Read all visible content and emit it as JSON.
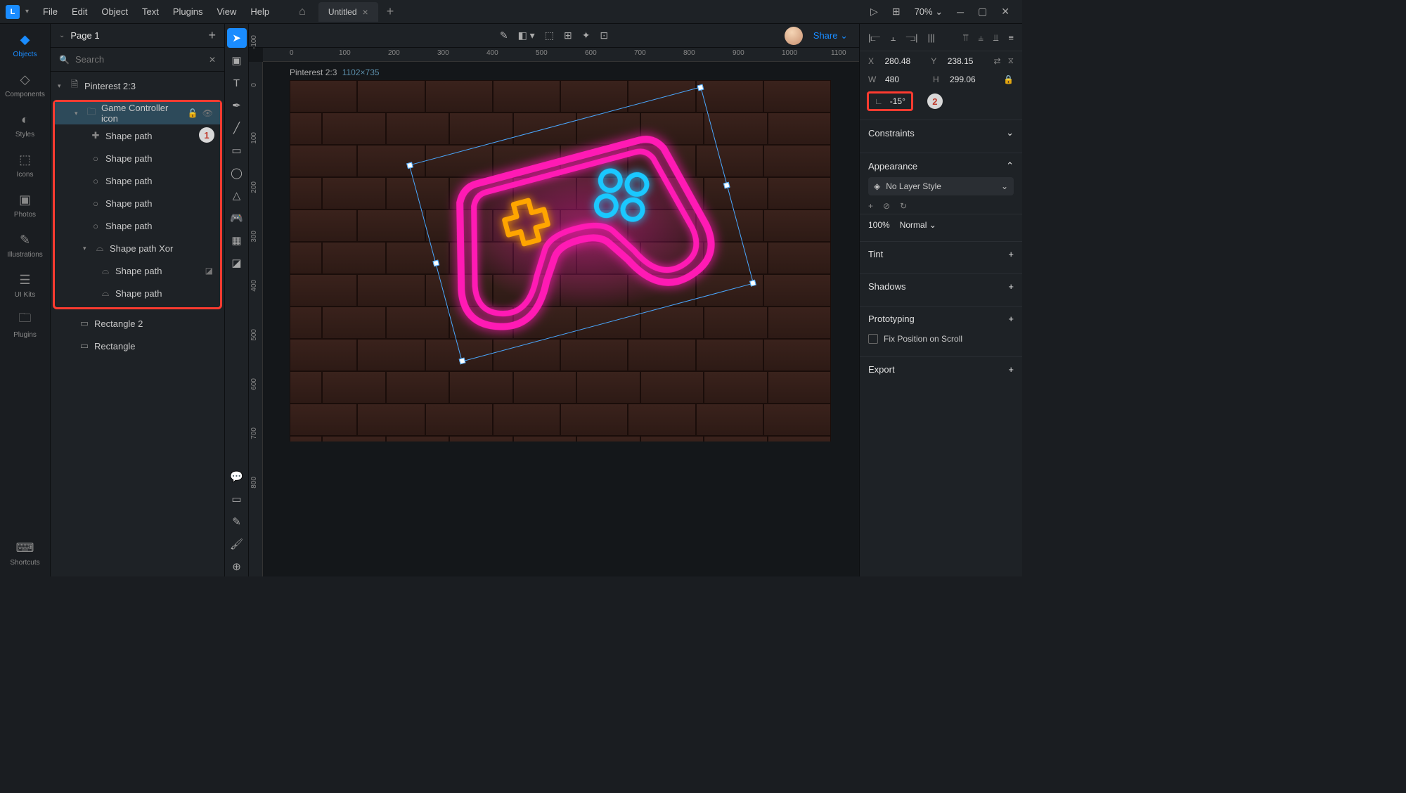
{
  "menubar": {
    "items": [
      "File",
      "Edit",
      "Object",
      "Text",
      "Plugins",
      "View",
      "Help"
    ],
    "tab_title": "Untitled",
    "zoom": "70%"
  },
  "rail": {
    "items": [
      {
        "label": "Objects",
        "icon": "layers-icon",
        "active": true
      },
      {
        "label": "Components",
        "icon": "components-icon"
      },
      {
        "label": "Styles",
        "icon": "styles-icon"
      },
      {
        "label": "Icons",
        "icon": "icons-icon"
      },
      {
        "label": "Photos",
        "icon": "photos-icon"
      },
      {
        "label": "Illustrations",
        "icon": "illustrations-icon"
      },
      {
        "label": "UI Kits",
        "icon": "uikits-icon"
      },
      {
        "label": "Plugins",
        "icon": "plugins-icon"
      },
      {
        "label": "Shortcuts",
        "icon": "shortcuts-icon"
      }
    ]
  },
  "layers": {
    "page_name": "Page 1",
    "search_placeholder": "Search",
    "root": "Pinterest 2:3",
    "group_name": "Game Controller icon",
    "shape_label": "Shape path",
    "xor_label": "Shape path Xor",
    "rect2": "Rectangle 2",
    "rect": "Rectangle"
  },
  "callouts": {
    "one": "1",
    "two": "2"
  },
  "canvas": {
    "artboard_name": "Pinterest 2:3",
    "artboard_dims": "1102×735",
    "ruler_h": [
      "0",
      "100",
      "200",
      "300",
      "400",
      "500",
      "600",
      "700",
      "800",
      "900",
      "1000",
      "1100"
    ],
    "ruler_v": [
      "-100",
      "0",
      "100",
      "200",
      "300",
      "400",
      "500",
      "600",
      "700",
      "800"
    ],
    "share": "Share"
  },
  "inspector": {
    "x_label": "X",
    "x_val": "280.48",
    "y_label": "Y",
    "y_val": "238.15",
    "w_label": "W",
    "w_val": "480",
    "h_label": "H",
    "h_val": "299.06",
    "rot_val": "-15°",
    "constraints": "Constraints",
    "appearance": "Appearance",
    "no_layer_style": "No Layer Style",
    "opacity": "100%",
    "blend": "Normal",
    "tint": "Tint",
    "shadows": "Shadows",
    "prototyping": "Prototyping",
    "fix_pos": "Fix Position on Scroll",
    "export": "Export"
  }
}
